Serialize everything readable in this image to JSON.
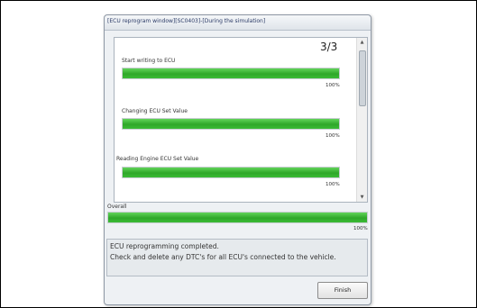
{
  "window": {
    "title": "[ECU reprogram window][SC0403]-[During the simulation]"
  },
  "panel": {
    "page_counter": "3/3",
    "tasks": [
      {
        "label": "Start writing to ECU",
        "progress_percent": 100,
        "progress_text": "100%"
      },
      {
        "label": "Changing ECU Set Value",
        "progress_percent": 100,
        "progress_text": "100%"
      },
      {
        "label": "Reading Engine ECU Set Value",
        "progress_percent": 100,
        "progress_text": "100%"
      }
    ]
  },
  "overall": {
    "label": "Overall",
    "progress_percent": 100,
    "progress_text": "100%"
  },
  "message": {
    "lines": [
      "ECU reprogramming completed.",
      "Check and delete any DTC's for all ECU's connected to the vehicle."
    ]
  },
  "buttons": {
    "finish_label": "Finish"
  },
  "colors": {
    "progress_fill": "#3bbb35",
    "progress_track": "#e4e8ea"
  },
  "icons": {
    "scroll_up": "chevron-up-icon",
    "scroll_down": "chevron-down-icon"
  }
}
